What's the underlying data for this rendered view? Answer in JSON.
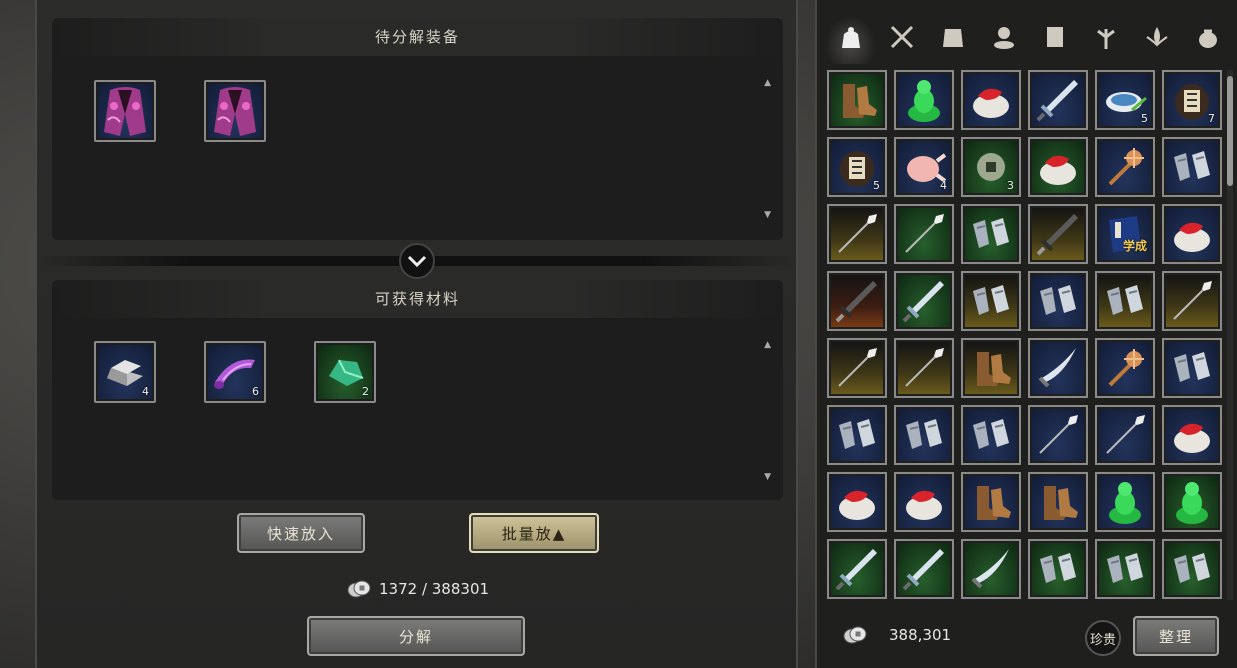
{
  "decompose": {
    "pending_title": "待分解装备",
    "materials_title": "可获得材料",
    "pending_items": [
      {
        "icon": "robe-icon",
        "quality": "blue"
      },
      {
        "icon": "robe-icon",
        "quality": "blue"
      }
    ],
    "material_items": [
      {
        "icon": "silver-ingot-icon",
        "quality": "blue",
        "count": "4"
      },
      {
        "icon": "cloth-roll-icon",
        "quality": "blue",
        "count": "6"
      },
      {
        "icon": "jade-stone-icon",
        "quality": "green",
        "count": "2"
      }
    ],
    "quick_add_label": "快速放入",
    "batch_add_label": "批量放▲",
    "cost_text": "1372 / 388301",
    "decompose_label": "分解"
  },
  "inventory": {
    "tabs": [
      {
        "icon": "bag-icon",
        "active": true
      },
      {
        "icon": "crossed-swords-icon",
        "active": false
      },
      {
        "icon": "armor-icon",
        "active": false
      },
      {
        "icon": "medal-icon",
        "active": false
      },
      {
        "icon": "book-icon",
        "active": false
      },
      {
        "icon": "herb-icon",
        "active": false
      },
      {
        "icon": "lotus-icon",
        "active": false
      },
      {
        "icon": "pouch-icon",
        "active": false
      }
    ],
    "items": [
      {
        "icon": "boots-icon",
        "quality": "green",
        "count": ""
      },
      {
        "icon": "jade-buddha-icon",
        "quality": "blue",
        "count": ""
      },
      {
        "icon": "bun-icon",
        "quality": "blue",
        "count": ""
      },
      {
        "icon": "sword-icon",
        "quality": "blue",
        "count": ""
      },
      {
        "icon": "tea-bowl-icon",
        "quality": "blue",
        "count": "5"
      },
      {
        "icon": "medicine-jar-icon",
        "quality": "blue",
        "count": "7"
      },
      {
        "icon": "medicine-jar-icon",
        "quality": "blue",
        "count": "5"
      },
      {
        "icon": "roast-chicken-icon",
        "quality": "blue",
        "count": "4"
      },
      {
        "icon": "coin-icon",
        "quality": "green",
        "count": "3"
      },
      {
        "icon": "bun-icon",
        "quality": "green",
        "count": ""
      },
      {
        "icon": "mace-icon",
        "quality": "blue",
        "count": ""
      },
      {
        "icon": "gauntlet-icon",
        "quality": "blue",
        "count": ""
      },
      {
        "icon": "spear-icon",
        "quality": "gold",
        "count": ""
      },
      {
        "icon": "spear-icon",
        "quality": "green",
        "count": ""
      },
      {
        "icon": "gauntlet-icon",
        "quality": "green",
        "count": ""
      },
      {
        "icon": "dark-sword-icon",
        "quality": "gold",
        "count": ""
      },
      {
        "icon": "manual-book-icon",
        "quality": "blue",
        "count": "",
        "label": "学成"
      },
      {
        "icon": "bun-icon",
        "quality": "blue",
        "count": ""
      },
      {
        "icon": "dark-sword-icon",
        "quality": "red",
        "count": ""
      },
      {
        "icon": "sword-icon",
        "quality": "green",
        "count": ""
      },
      {
        "icon": "gauntlet-icon",
        "quality": "gold",
        "count": ""
      },
      {
        "icon": "gauntlet-icon",
        "quality": "blue",
        "count": ""
      },
      {
        "icon": "gauntlet-icon",
        "quality": "gold",
        "count": ""
      },
      {
        "icon": "spear-icon",
        "quality": "gold",
        "count": ""
      },
      {
        "icon": "spear-icon",
        "quality": "gold",
        "count": ""
      },
      {
        "icon": "spear-icon",
        "quality": "gold",
        "count": ""
      },
      {
        "icon": "boots-icon",
        "quality": "gold",
        "count": ""
      },
      {
        "icon": "saber-icon",
        "quality": "blue",
        "count": ""
      },
      {
        "icon": "mace-icon",
        "quality": "blue",
        "count": ""
      },
      {
        "icon": "gauntlet-icon",
        "quality": "blue",
        "count": ""
      },
      {
        "icon": "gauntlet-icon",
        "quality": "blue",
        "count": ""
      },
      {
        "icon": "gauntlet-icon",
        "quality": "blue",
        "count": ""
      },
      {
        "icon": "gauntlet-icon",
        "quality": "blue",
        "count": ""
      },
      {
        "icon": "spear-icon",
        "quality": "blue",
        "count": ""
      },
      {
        "icon": "spear-icon",
        "quality": "blue",
        "count": ""
      },
      {
        "icon": "bun-icon",
        "quality": "blue",
        "count": ""
      },
      {
        "icon": "bun-icon",
        "quality": "blue",
        "count": ""
      },
      {
        "icon": "bun-icon",
        "quality": "blue",
        "count": ""
      },
      {
        "icon": "boots-icon",
        "quality": "blue",
        "count": ""
      },
      {
        "icon": "boots-icon",
        "quality": "blue",
        "count": ""
      },
      {
        "icon": "jade-buddha-icon",
        "quality": "blue",
        "count": ""
      },
      {
        "icon": "jade-buddha-icon",
        "quality": "green",
        "count": ""
      },
      {
        "icon": "sword-icon",
        "quality": "green",
        "count": ""
      },
      {
        "icon": "sword-icon",
        "quality": "green",
        "count": ""
      },
      {
        "icon": "saber-icon",
        "quality": "green",
        "count": ""
      },
      {
        "icon": "gauntlet-icon",
        "quality": "green",
        "count": ""
      },
      {
        "icon": "gauntlet-icon",
        "quality": "green",
        "count": ""
      },
      {
        "icon": "gauntlet-icon",
        "quality": "green",
        "count": ""
      }
    ],
    "money": "388,301",
    "treasure_label": "珍贵",
    "sort_label": "整理"
  },
  "colors": {
    "quality_blue": "#1b2a4e",
    "quality_green": "#1c4a20",
    "quality_gold": "#5e501a",
    "quality_red": "#6b3414",
    "button_active": "#cfc49a"
  }
}
